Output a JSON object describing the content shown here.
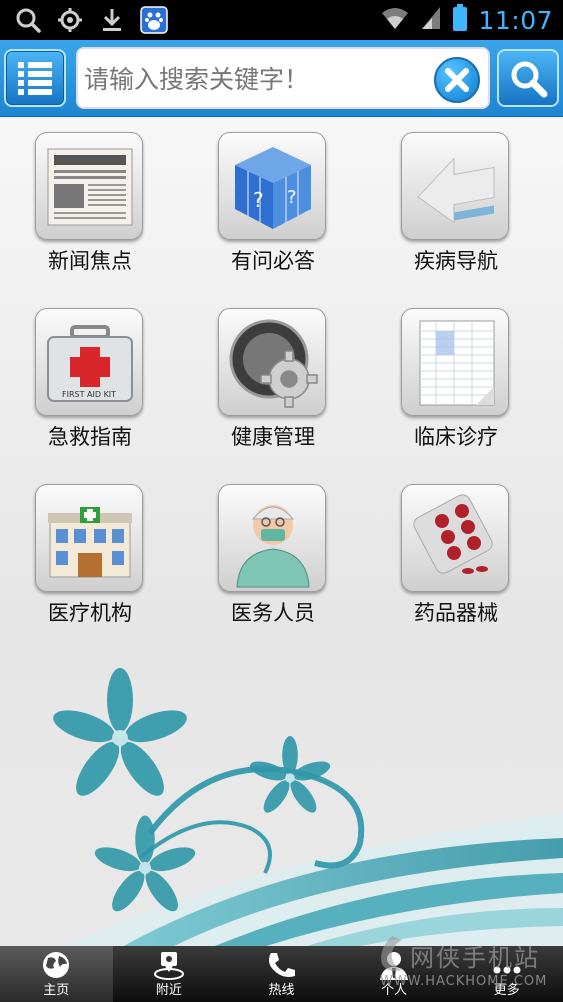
{
  "status_bar": {
    "time": "11:07",
    "icons": [
      "search-icon",
      "location-target-icon",
      "download-icon",
      "baidu-icon",
      "wifi-icon",
      "signal-icon",
      "battery-icon"
    ]
  },
  "search": {
    "placeholder": "请输入搜索关键字！",
    "value": ""
  },
  "grid": {
    "items": [
      {
        "label": "新闻焦点",
        "icon": "newspaper-icon"
      },
      {
        "label": "有问必答",
        "icon": "question-cube-icon"
      },
      {
        "label": "疾病导航",
        "icon": "arrow-icon"
      },
      {
        "label": "急救指南",
        "icon": "first-aid-kit-icon"
      },
      {
        "label": "健康管理",
        "icon": "gear-monitor-icon"
      },
      {
        "label": "临床诊疗",
        "icon": "spreadsheet-icon"
      },
      {
        "label": "医疗机构",
        "icon": "hospital-building-icon"
      },
      {
        "label": "医务人员",
        "icon": "doctor-icon"
      },
      {
        "label": "药品器械",
        "icon": "pill-blister-icon"
      }
    ]
  },
  "bottom_nav": {
    "items": [
      {
        "label": "主页",
        "icon": "globe-icon",
        "active": true
      },
      {
        "label": "附近",
        "icon": "map-pin-icon",
        "active": false
      },
      {
        "label": "热线",
        "icon": "phone-icon",
        "active": false
      },
      {
        "label": "个人",
        "icon": "person-icon",
        "active": false
      },
      {
        "label": "更多",
        "icon": "more-dots-icon",
        "active": false
      }
    ]
  },
  "watermark": {
    "text": "网侠手机站",
    "url": "WWW.HACKHOME.COM"
  },
  "colors": {
    "accent_blue": "#1d86d3",
    "status_text": "#3fb6ff",
    "floral_teal": "#2f98a8"
  }
}
